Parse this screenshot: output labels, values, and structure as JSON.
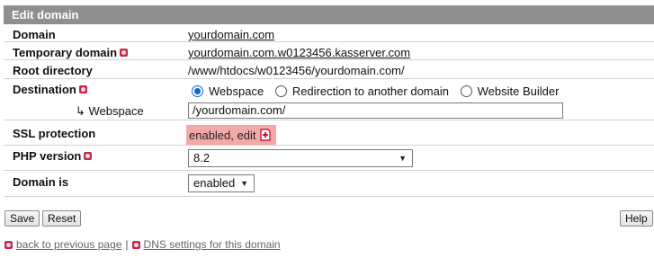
{
  "header": {
    "title": "Edit domain"
  },
  "fields": {
    "domain": {
      "label": "Domain",
      "value": "yourdomain.com"
    },
    "temp_domain": {
      "label": "Temporary domain",
      "value": "yourdomain.com.w0123456.kasserver.com"
    },
    "root_dir": {
      "label": "Root directory",
      "value": "/www/htdocs/w0123456/yourdomain.com/"
    },
    "destination": {
      "label": "Destination",
      "options": [
        "Webspace",
        "Redirection to another domain",
        "Website Builder"
      ],
      "selected": "Webspace"
    },
    "webspace": {
      "label": "↳ Webspace",
      "value": "/yourdomain.com/"
    },
    "ssl": {
      "label": "SSL protection",
      "value": "enabled, edit"
    },
    "php": {
      "label": "PHP version",
      "value": "8.2"
    },
    "domain_is": {
      "label": "Domain is",
      "value": "enabled"
    }
  },
  "buttons": {
    "save": "Save",
    "reset": "Reset",
    "help": "Help"
  },
  "footer": {
    "back": "back to previous page",
    "separator": "|",
    "dns": "DNS settings for this domain"
  },
  "colors": {
    "header_bg": "#8f8f8f",
    "help_icon": "#c8284a",
    "ssl_bg": "#f4a9a9",
    "radio_accent": "#0a66d6"
  }
}
